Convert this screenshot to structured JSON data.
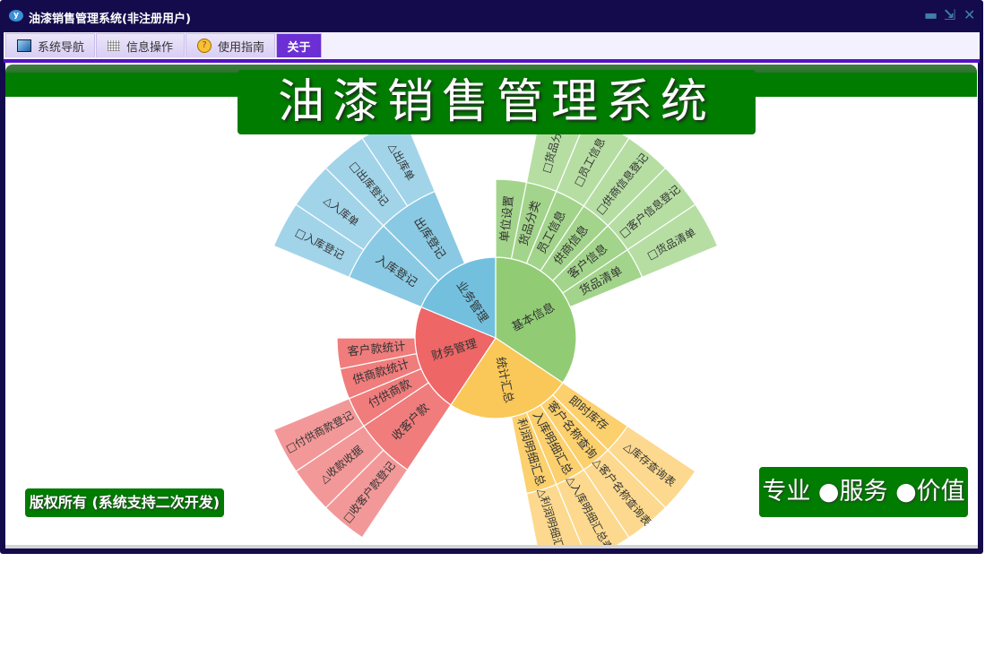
{
  "window": {
    "title": "油漆销售管理系统(非注册用户)",
    "app_icon": "y",
    "controls": {
      "minimize": "▬",
      "restore": "⇲",
      "close": "✕"
    }
  },
  "tabs": [
    {
      "label": "系统导航",
      "icon": "monitor-icon",
      "active": false
    },
    {
      "label": "信息操作",
      "icon": "grid-icon",
      "active": false
    },
    {
      "label": "使用指南",
      "icon": "help-icon",
      "active": false
    },
    {
      "label": "关于",
      "icon": "",
      "active": true
    }
  ],
  "banner": {
    "title": "油漆销售管理系统"
  },
  "footer": {
    "copyright": "版权所有 (系统支持二次开发)",
    "slogan": "专业 ●服务 ●价值"
  },
  "colors": {
    "frame": "#140b4c",
    "accent": "#5510c6",
    "banner_green": "#007c00"
  },
  "chart_data": {
    "type": "sunburst",
    "title": "",
    "total": 32,
    "series": [
      {
        "name": "基本信息",
        "value": 11,
        "colors": [
          "#91cc75",
          "#a3d48b",
          "#b6dea3"
        ],
        "children": [
          {
            "name": "单位设置",
            "value": 1
          },
          {
            "name": "货品分类",
            "value": 1,
            "children": [
              {
                "name": "□货品分类",
                "value": 1
              }
            ]
          },
          {
            "name": "员工信息",
            "value": 1,
            "children": [
              {
                "name": "□员工信息",
                "value": 1
              }
            ]
          },
          {
            "name": "供商信息",
            "value": 1,
            "children": [
              {
                "name": "□供商信息登记",
                "value": 1
              }
            ]
          },
          {
            "name": "客户信息",
            "value": 1,
            "children": [
              {
                "name": "□客户信息登记",
                "value": 1
              }
            ]
          },
          {
            "name": "货品清单",
            "value": 1,
            "children": [
              {
                "name": "□货品清单",
                "value": 1
              }
            ]
          }
        ]
      },
      {
        "name": "统计汇总",
        "value": 8,
        "colors": [
          "#fac858",
          "#fbd06d",
          "#fcd98e"
        ],
        "children": [
          {
            "name": "即时库存",
            "value": 1,
            "children": [
              {
                "name": "△库存查询表",
                "value": 1
              }
            ]
          },
          {
            "name": "客户名称查询",
            "value": 1,
            "children": [
              {
                "name": "△客户名称查询表",
                "value": 1
              }
            ]
          },
          {
            "name": "入库明细汇总",
            "value": 1,
            "children": [
              {
                "name": "△入库明细汇总表",
                "value": 1
              }
            ]
          },
          {
            "name": "利润明细汇总",
            "value": 1,
            "children": [
              {
                "name": "△利润明细汇总表",
                "value": 1
              }
            ]
          }
        ]
      },
      {
        "name": "财务管理",
        "value": 7,
        "colors": [
          "#ee6666",
          "#f07c7c",
          "#f39898"
        ],
        "children": [
          {
            "name": "收客户款",
            "value": 2,
            "children": [
              {
                "name": "□收客户款登记",
                "value": 1
              },
              {
                "name": "△收款收据",
                "value": 1
              }
            ]
          },
          {
            "name": "付供商款",
            "value": 1,
            "children": [
              {
                "name": "□付供商款登记",
                "value": 1
              }
            ]
          },
          {
            "name": "供商款统计",
            "value": 1
          },
          {
            "name": "客户款统计",
            "value": 1
          }
        ]
      },
      {
        "name": "业务管理",
        "value": 6,
        "colors": [
          "#73c0de",
          "#89c9e3",
          "#a1d4e9"
        ],
        "children": [
          {
            "name": "入库登记",
            "value": 2,
            "children": [
              {
                "name": "□入库登记",
                "value": 1
              },
              {
                "name": "△入库单",
                "value": 1
              }
            ]
          },
          {
            "name": "出库登记",
            "value": 2,
            "children": [
              {
                "name": "□出库登记",
                "value": 1
              },
              {
                "name": "△出库单",
                "value": 1
              }
            ]
          }
        ]
      }
    ]
  }
}
